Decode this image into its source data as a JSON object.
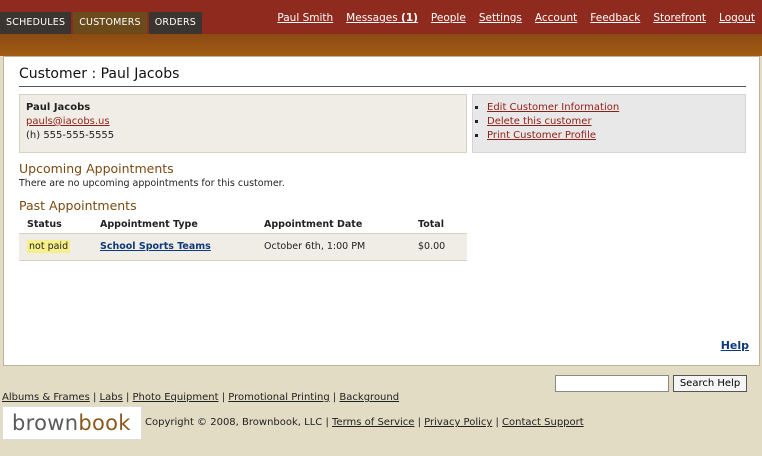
{
  "nav": {
    "tabs": [
      {
        "label": "SCHEDULES"
      },
      {
        "label": "CUSTOMERS"
      },
      {
        "label": "ORDERS"
      }
    ],
    "user": "Paul Smith",
    "messages_label": "Messages",
    "messages_count": "(1)",
    "links": [
      "People",
      "Settings",
      "Account",
      "Feedback",
      "Storefront",
      "Logout"
    ]
  },
  "page": {
    "title": "Customer : Paul Jacobs"
  },
  "customer": {
    "name": "Paul Jacobs",
    "email": "pauls@iacobs.us",
    "phone": "(h) 555-555-5555"
  },
  "actions": [
    "Edit Customer Information",
    "Delete this customer",
    "Print Customer Profile"
  ],
  "upcoming": {
    "heading": "Upcoming Appointments",
    "empty_text": "There are no upcoming appointments for this customer."
  },
  "past": {
    "heading": "Past Appointments",
    "columns": [
      "Status",
      "Appointment Type",
      "Appointment Date",
      "Total"
    ],
    "rows": [
      {
        "status": "not paid",
        "type": "School Sports Teams",
        "date": "October 6th, 1:00 PM",
        "total": "$0.00"
      }
    ]
  },
  "help_label": "Help",
  "search": {
    "value": "",
    "button": "Search Help"
  },
  "footer": {
    "links": [
      "Albums & Frames",
      "Labs",
      "Photo Equipment",
      "Promotional Printing",
      "Background"
    ],
    "logo_part1": "brown",
    "logo_part2": "book",
    "copyright": "Copyright © 2008, Brownbook, LLC |",
    "legal_links": [
      "Terms of Service",
      "Privacy Policy",
      "Contact Support"
    ]
  },
  "colors": {
    "header": "#8e2a1e",
    "accent_link": "#8e1e16",
    "status_highlight": "#f7f08a"
  }
}
